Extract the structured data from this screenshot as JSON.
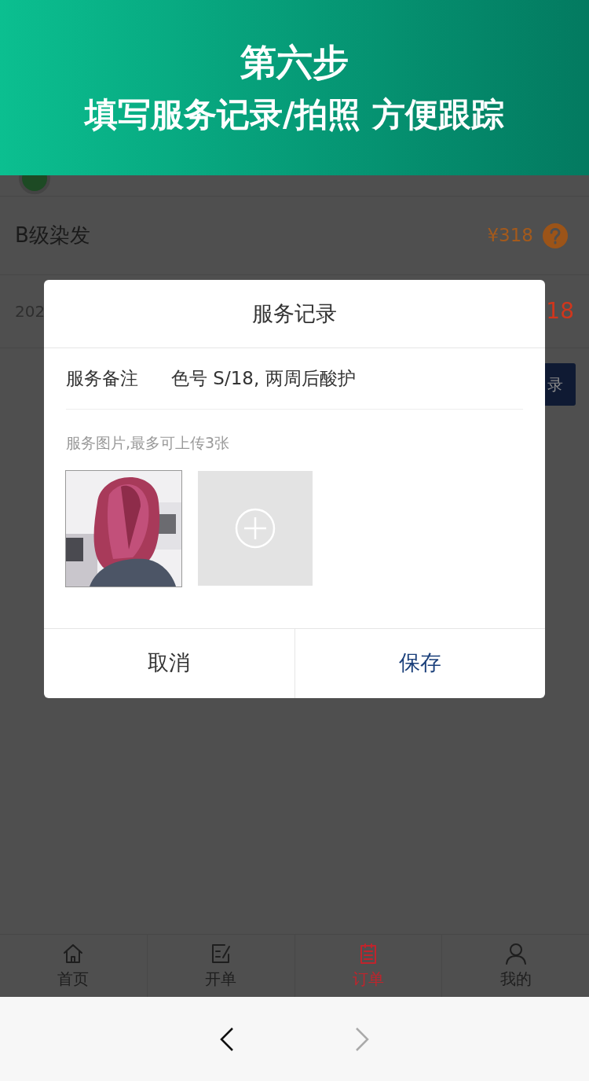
{
  "banner": {
    "title": "第六步",
    "subtitle": "填写服务记录/拍照 方便跟踪"
  },
  "order": {
    "service": "B级染发",
    "price": "¥318",
    "date_partial": "202",
    "total_partial": "18",
    "button_partial": "录"
  },
  "dialog": {
    "title": "服务记录",
    "note_label": "服务备注",
    "note_value": "色号 S/18, 两周后酸护",
    "photos_hint": "服务图片,最多可上传3张",
    "buttons": [
      {
        "label": "取消",
        "kind": "cancel"
      },
      {
        "label": "保存",
        "kind": "primary"
      }
    ]
  },
  "tab_bar": [
    {
      "label": "首页",
      "selected": false
    },
    {
      "label": "开单",
      "selected": false
    },
    {
      "label": "订单",
      "selected": true
    },
    {
      "label": "我的",
      "selected": false
    }
  ],
  "browser_bar": {
    "back_disabled": false,
    "forward_disabled": true
  }
}
